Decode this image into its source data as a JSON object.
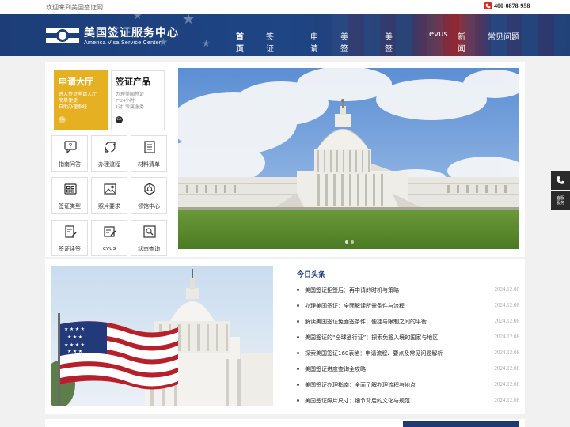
{
  "topbar": {
    "welcome": "欢迎来到美国签证网",
    "phone": "400-0878-958"
  },
  "brand": {
    "name_cn": "美国签证服务中心",
    "name_en": "America Visa Service Center"
  },
  "nav": {
    "items": [
      "首页",
      "签证指南",
      "申请",
      "美签材料",
      "美签类别",
      "evus",
      "新闻",
      "常见问题"
    ]
  },
  "features": {
    "hall": {
      "title": "申请大厅",
      "desc": [
        "进入签证申请大厅",
        "简单便捷",
        "自助办理系统"
      ]
    },
    "product": {
      "title": "签证产品",
      "desc": [
        "办理美国签证",
        "7*24小时",
        "1对1专属服务"
      ]
    }
  },
  "tiles": [
    {
      "label": "指南问答",
      "icon": "chat-question-icon"
    },
    {
      "label": "办理流程",
      "icon": "process-cycle-icon"
    },
    {
      "label": "材料清单",
      "icon": "checklist-icon"
    },
    {
      "label": "签证类型",
      "icon": "category-grid-icon"
    },
    {
      "label": "照片要求",
      "icon": "photo-icon"
    },
    {
      "label": "领馆中心",
      "icon": "consulate-network-icon"
    },
    {
      "label": "签证续签",
      "icon": "renew-document-icon"
    },
    {
      "label": "evus",
      "icon": "evus-edit-icon"
    },
    {
      "label": "状态查询",
      "icon": "status-search-icon"
    }
  ],
  "news": {
    "heading": "今日头条",
    "items": [
      {
        "title": "美国签证拒签后：再申请的时机与策略",
        "date": "2024.12.08"
      },
      {
        "title": "办理美国签证：全面解读所需条件与流程",
        "date": "2024.12.08"
      },
      {
        "title": "解读美国签证免面签条件：便捷与限制之间的平衡",
        "date": "2024.12.08"
      },
      {
        "title": "美国签证的“全球通行证”：探索免签入境的国家与地区",
        "date": "2024.12.08"
      },
      {
        "title": "探索美国签证160表格：申请流程、要点及常见问题解析",
        "date": "2024.12.08"
      },
      {
        "title": "美国签证进度查询全攻略",
        "date": "2024.12.08"
      },
      {
        "title": "美国签证办理指南：全面了解办理流程与地点",
        "date": "2024.12.08"
      },
      {
        "title": "美国签证照片尺寸：细节背后的文化与规范",
        "date": "2024.12.08"
      }
    ]
  },
  "float": {
    "phone_icon": "phone-icon",
    "service_label": [
      "客服",
      "服务"
    ]
  },
  "colors": {
    "brand_blue": "#1c3d78",
    "accent_gold": "#e5b021",
    "phone_red": "#e0281e"
  }
}
